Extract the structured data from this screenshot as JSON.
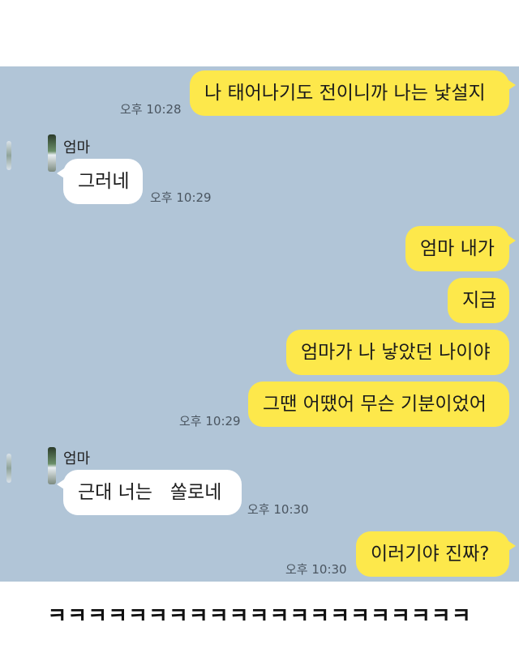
{
  "chat": {
    "messages": [
      {
        "text": "나 태어나기도 전이니까 나는 낯설지",
        "time": "오후 10:28"
      },
      {
        "sender": "엄마",
        "text": "그러네",
        "time": "오후 10:29"
      },
      {
        "text": "엄마 내가"
      },
      {
        "text": "지금"
      },
      {
        "text": "엄마가 나 낳았던 나이야"
      },
      {
        "text": "그땐 어땠어 무슨 기분이었어",
        "time": "오후 10:29"
      },
      {
        "sender": "엄마",
        "text": "근대 너는   쏠로네",
        "time": "오후 10:30"
      },
      {
        "text": "이러기야 진짜?",
        "time": "오후 10:30"
      }
    ]
  },
  "caption": "ㅋㅋㅋㅋㅋㅋㅋㅋㅋㅋㅋㅋㅋㅋㅋㅋㅋㅋㅋㅋㅋ",
  "colors": {
    "chat_background": "#b1c5d7",
    "my_bubble": "#fde84b",
    "their_bubble": "#ffffff"
  }
}
